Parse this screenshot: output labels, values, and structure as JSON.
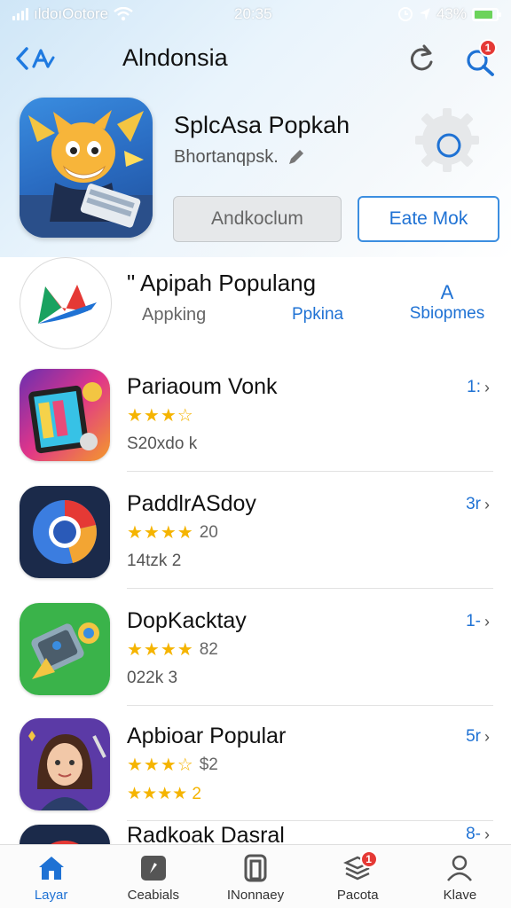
{
  "status_bar": {
    "carrier": "ıldoıOotore",
    "time": "20:35",
    "battery_percent": "43%",
    "battery_level": 0.85
  },
  "nav": {
    "back_label": "<A",
    "title": "Alndonsia",
    "search_badge": "1"
  },
  "featured": {
    "title": "SplcAsa Popkah",
    "subtitle": "Bhortanqpsk.",
    "secondary_button": "Andkoclum",
    "primary_button": "Eate Mok"
  },
  "category": {
    "title": "\" Apipah Populang",
    "subtitle": "Appking",
    "link": "Ppkina",
    "more_top": "A",
    "more_bottom": "Sbiopmes"
  },
  "apps": [
    {
      "name": "Pariaoum Vonk",
      "stars": "★★★☆",
      "rating_text": "",
      "size": "S20xdo k",
      "action": "1:"
    },
    {
      "name": "PaddlrASdoy",
      "stars": "★★★★",
      "rating_text": "20",
      "size": "14tzk 2",
      "action": "3r"
    },
    {
      "name": "DopKacktay",
      "stars": "★★★★",
      "rating_text": "82",
      "size": "022k 3",
      "action": "1-"
    },
    {
      "name": "Apbioar Popular",
      "stars": "★★★☆",
      "rating_text": "$2",
      "size": "★★★★ 2",
      "action": "5r"
    },
    {
      "name": "Radkoak Dasral",
      "stars": "",
      "rating_text": "",
      "size": "",
      "action": "8-"
    }
  ],
  "tabs": [
    {
      "label": "Layar",
      "icon": "home-icon",
      "active": true
    },
    {
      "label": "Ceabials",
      "icon": "edit-icon",
      "active": false
    },
    {
      "label": "INonnaey",
      "icon": "apps-icon",
      "active": false
    },
    {
      "label": "Pacota",
      "icon": "stack-icon",
      "active": false,
      "badge": "1"
    },
    {
      "label": "Klave",
      "icon": "profile-icon",
      "active": false
    }
  ],
  "colors": {
    "accent": "#1f72d4",
    "star": "#f5b400",
    "badge": "#e53935"
  }
}
